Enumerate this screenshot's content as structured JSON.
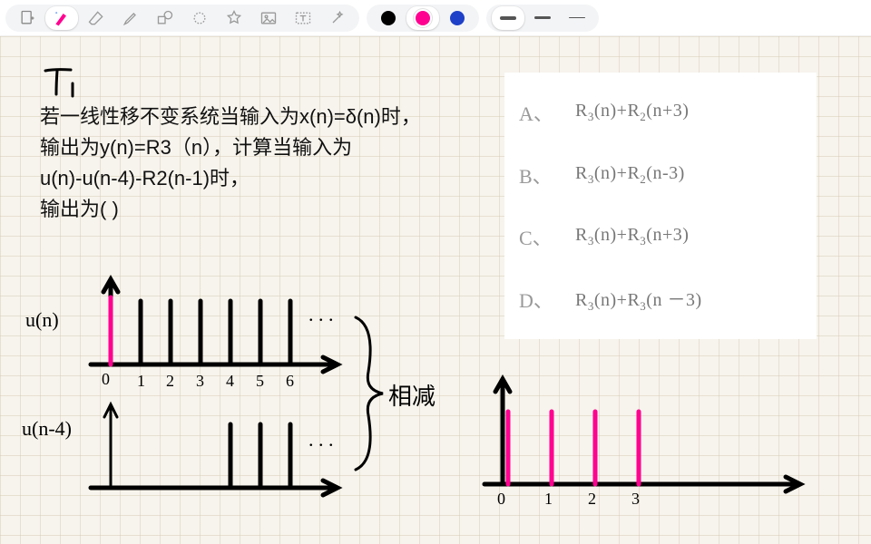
{
  "toolbar": {
    "colors": {
      "black": "#000000",
      "magenta": "#ff0090",
      "blue": "#1e40c8"
    },
    "tools": {
      "insert_page": "insert-page",
      "pen": "pen",
      "eraser": "eraser",
      "highlighter": "highlighter",
      "shapes": "shapes",
      "lasso": "lasso",
      "sticker": "sticker",
      "image": "image",
      "text": "text",
      "wand": "wand"
    }
  },
  "handwriting": {
    "title": "T₁",
    "un_label": "u(n)",
    "un4_label": "u(n-4)",
    "note": "相减",
    "plot1_xlabels": [
      "0",
      "1",
      "2",
      "3",
      "4",
      "5",
      "6"
    ],
    "plot3_xlabels": [
      "0",
      "1",
      "2",
      "3"
    ]
  },
  "problem": {
    "line1": "若一线性移不变系统当输入为x(n)=δ(n)时，",
    "line2": "输出为y(n)=R3（n），计算当输入为",
    "line3": "u(n)-u(n-4)-R2(n-1)时，",
    "line4": "输出为(        )"
  },
  "options": [
    {
      "label": "A、",
      "html": "R<span class=\"sub\">3</span>(n)+R<span class=\"sub\">2</span>(n+3)"
    },
    {
      "label": "B、",
      "html": "R<span class=\"sub\">3</span>(n)+R<span class=\"sub\">2</span>(n-3)"
    },
    {
      "label": "C、",
      "html": "R<span class=\"sub\">3</span>(n)+R<span class=\"sub\">3</span>(n+3)"
    },
    {
      "label": "D、",
      "html": "R<span class=\"sub\">3</span>(n)+R<span class=\"sub\">3</span>(n －3)"
    }
  ]
}
